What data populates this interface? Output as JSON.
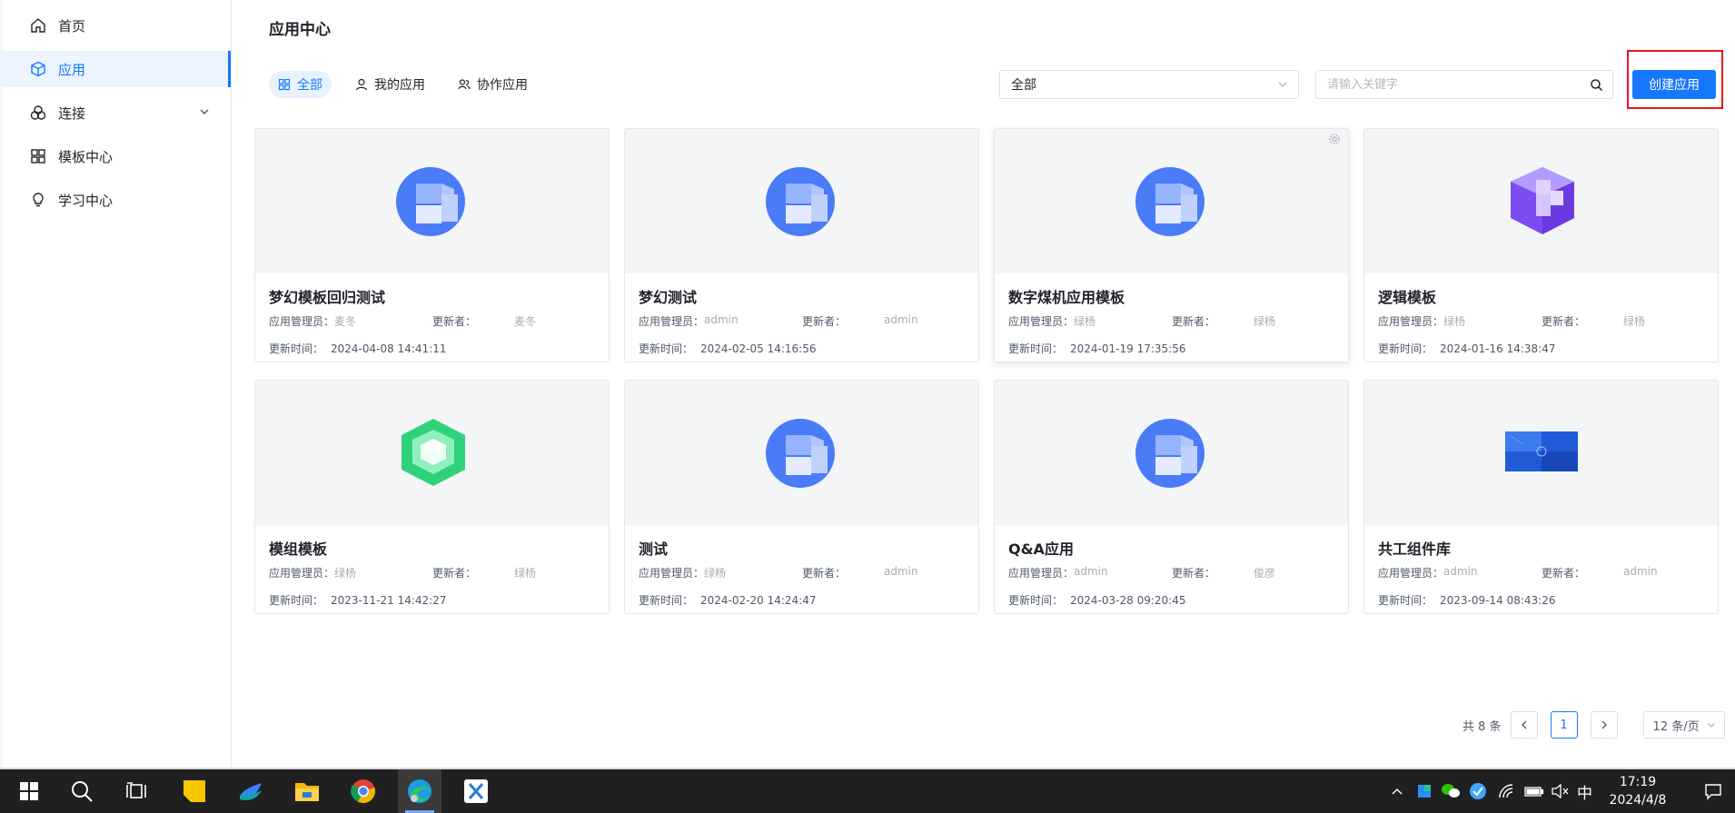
{
  "sidebar": {
    "items": [
      {
        "label": "首页",
        "icon": "home-icon"
      },
      {
        "label": "应用",
        "icon": "cube-icon",
        "active": true
      },
      {
        "label": "连接",
        "icon": "link-icon",
        "expandable": true
      },
      {
        "label": "模板中心",
        "icon": "grid-icon"
      },
      {
        "label": "学习中心",
        "icon": "bulb-icon"
      }
    ]
  },
  "header": {
    "title": "应用中心"
  },
  "filters": {
    "tabs": [
      {
        "label": "全部",
        "icon": "grid-icon",
        "active": true
      },
      {
        "label": "我的应用",
        "icon": "user-icon"
      },
      {
        "label": "协作应用",
        "icon": "users-icon"
      }
    ],
    "select_value": "全部",
    "search_placeholder": "请输入关键字",
    "create_label": "创建应用"
  },
  "card_labels": {
    "manager": "应用管理员：",
    "updater": "更新者：",
    "updated_time": "更新时间："
  },
  "apps": [
    {
      "name": "梦幻模板回归测试",
      "manager": "麦冬",
      "updater": "麦冬",
      "time": "2024-04-08 14:41:11",
      "art": "blue"
    },
    {
      "name": "梦幻测试",
      "manager": "admin",
      "updater": "admin",
      "time": "2024-02-05 14:16:56",
      "art": "blue"
    },
    {
      "name": "数字煤机应用模板",
      "manager": "绿杨",
      "updater": "绿杨",
      "time": "2024-01-19 17:35:56",
      "art": "blue"
    },
    {
      "name": "逻辑模板",
      "manager": "绿杨",
      "updater": "绿杨",
      "time": "2024-01-16 14:38:47",
      "art": "purple"
    },
    {
      "name": "模组模板",
      "manager": "绿杨",
      "updater": "绿杨",
      "time": "2023-11-21 14:42:27",
      "art": "green"
    },
    {
      "name": "测试",
      "manager": "绿杨",
      "updater": "admin",
      "time": "2024-02-20 14:24:47",
      "art": "blue"
    },
    {
      "name": "Q&A应用",
      "manager": "admin",
      "updater": "俊彦",
      "time": "2024-03-28 09:20:45",
      "art": "blue"
    },
    {
      "name": "共工组件库",
      "manager": "admin",
      "updater": "admin",
      "time": "2023-09-14 08:43:26",
      "art": "banner"
    }
  ],
  "pagination": {
    "total": "共 8 条",
    "current": "1",
    "page_size": "12 条/页"
  },
  "taskbar": {
    "time": "17:19",
    "date": "2024/4/8",
    "ime": "中"
  },
  "colors": {
    "accent": "#1677ff",
    "highlight_box": "#e8141c",
    "taskbar": "#202020"
  }
}
